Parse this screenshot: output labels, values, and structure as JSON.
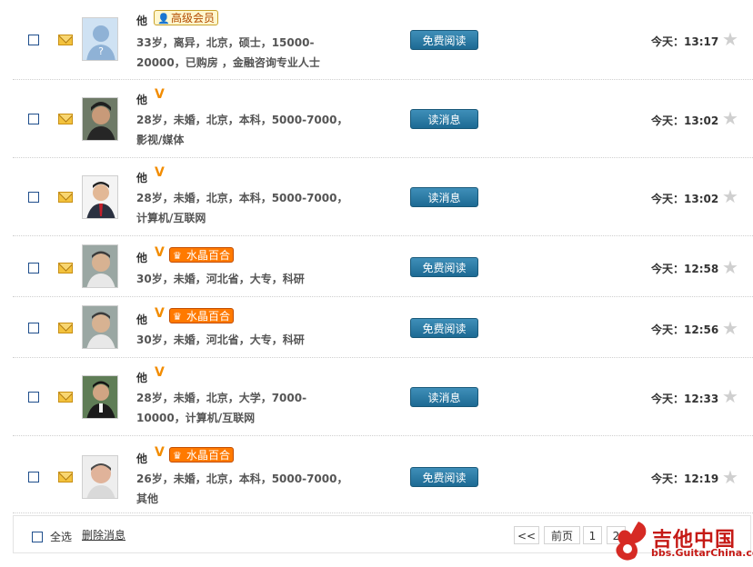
{
  "messages": [
    {
      "name": "他",
      "v_badge": "",
      "member_badge": "高级会员",
      "desc": "33岁，离异，北京，硕士，15000-20000，已购房  ，金融咨询专业人士",
      "button": "免费阅读",
      "time": "今天：13:17",
      "avatar": "default-avatar"
    },
    {
      "name": "他",
      "v_badge": "V",
      "member_badge": "",
      "desc": "28岁，未婚，北京，本科，5000-7000，影视/媒体",
      "button": "读消息",
      "time": "今天：13:02",
      "avatar": "user-photo"
    },
    {
      "name": "他",
      "v_badge": "V",
      "member_badge": "",
      "desc": "28岁，未婚，北京，本科，5000-7000，计算机/互联网",
      "button": "读消息",
      "time": "今天：13:02",
      "avatar": "user-photo"
    },
    {
      "name": "他",
      "v_badge": "V",
      "member_badge": "水晶百合",
      "desc": "30岁，未婚，河北省，大专，科研",
      "button": "免费阅读",
      "time": "今天：12:58",
      "avatar": "user-photo"
    },
    {
      "name": "他",
      "v_badge": "V",
      "member_badge": "水晶百合",
      "desc": "30岁，未婚，河北省，大专，科研",
      "button": "免费阅读",
      "time": "今天：12:56",
      "avatar": "user-photo"
    },
    {
      "name": "他",
      "v_badge": "V",
      "member_badge": "",
      "desc": "28岁，未婚，北京，大学，7000-10000，计算机/互联网",
      "button": "读消息",
      "time": "今天：12:33",
      "avatar": "user-photo"
    },
    {
      "name": "他",
      "v_badge": "V",
      "member_badge": "水晶百合",
      "desc": "26岁，未婚，北京，本科，5000-7000，其他",
      "button": "免费阅读",
      "time": "今天：12:19",
      "avatar": "user-photo"
    }
  ],
  "footer": {
    "select_all": "全选",
    "delete": "删除消息",
    "pagination": [
      "<<",
      "前页",
      "1",
      "2"
    ]
  },
  "watermark": {
    "title": "吉他中国",
    "url": "bbs.GuitarChina.com"
  },
  "colors": {
    "button": "#2a7aa4",
    "badge_crystal": "#ff7a00",
    "v_mark": "#f28c00",
    "watermark": "#c51a16"
  }
}
